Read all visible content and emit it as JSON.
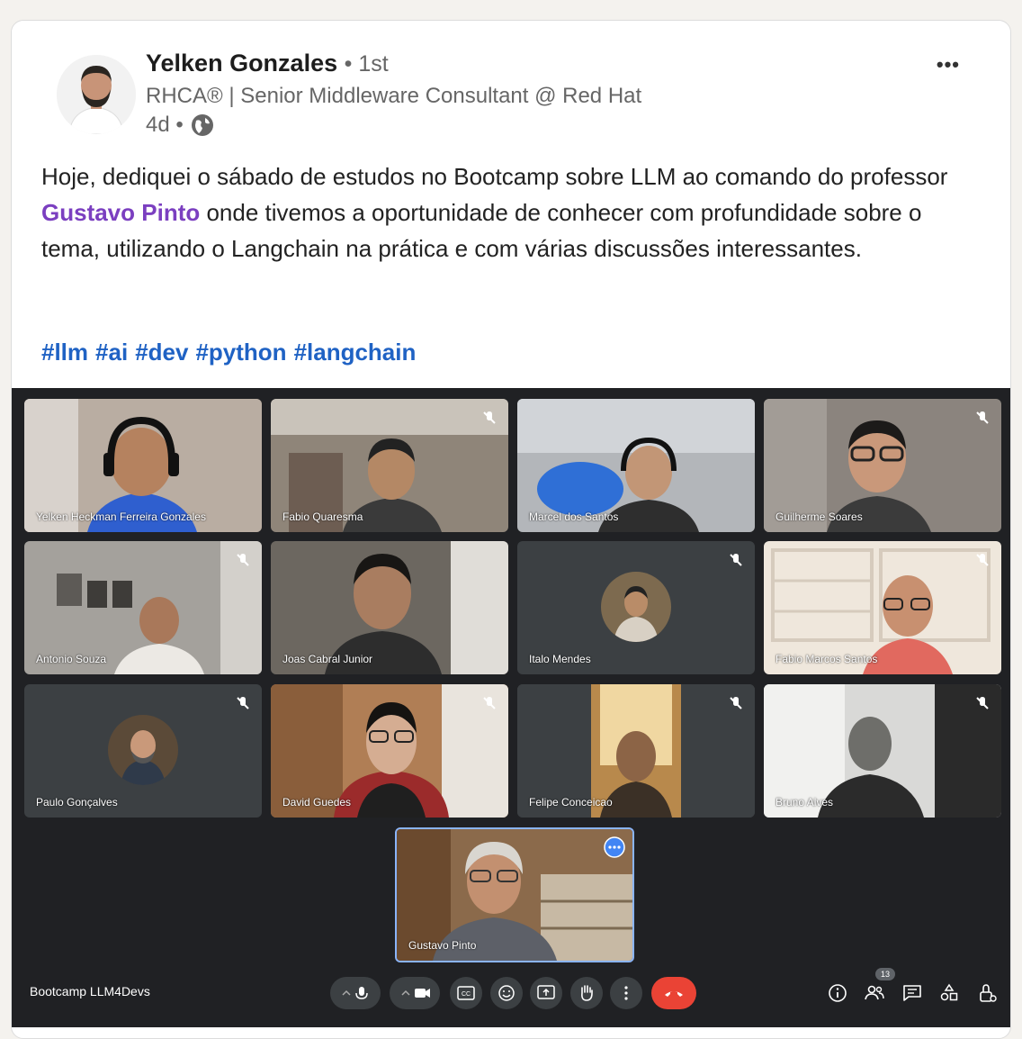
{
  "post": {
    "author": "Yelken Gonzales",
    "connection": "• 1st",
    "headline": "RHCA® | Senior Middleware Consultant @ Red Hat",
    "time": "4d •",
    "more_label": "•••",
    "text_part1": "Hoje, dediquei o sábado de estudos no Bootcamp sobre LLM ao comando do professor ",
    "mention": "Gustavo Pinto",
    "text_part2": " onde tivemos a oportunidade de conhecer com profundidade sobre o tema, utilizando o Langchain na prática e com várias discussões interessantes.",
    "hashtags": [
      "#llm",
      "#ai",
      "#dev",
      "#python",
      "#langchain"
    ]
  },
  "meeting": {
    "title": "Bootcamp LLM4Devs",
    "participant_count": "13",
    "participants": [
      {
        "name": "Yelken Heckman Ferreira Gonzales",
        "muted": false
      },
      {
        "name": "Fabio Quaresma",
        "muted": true
      },
      {
        "name": "Marcel dos Santos",
        "muted": false
      },
      {
        "name": "Guilherme Soares",
        "muted": true
      },
      {
        "name": "Antonio Souza",
        "muted": true
      },
      {
        "name": "Joas Cabral Junior",
        "muted": false
      },
      {
        "name": "Italo Mendes",
        "muted": true
      },
      {
        "name": "Fabio Marcos Santos",
        "muted": true
      },
      {
        "name": "Paulo Gonçalves",
        "muted": true
      },
      {
        "name": "David Guedes",
        "muted": true
      },
      {
        "name": "Felipe Conceicao",
        "muted": true
      },
      {
        "name": "Bruno Alves",
        "muted": true
      }
    ],
    "presenter": {
      "name": "Gustavo Pinto"
    }
  },
  "colors": {
    "mention": "#7b3fc0",
    "hashtag": "#1f62c4",
    "meet_bg": "#202124",
    "hangup": "#ea4335",
    "presenter_border": "#8ab4f8"
  }
}
